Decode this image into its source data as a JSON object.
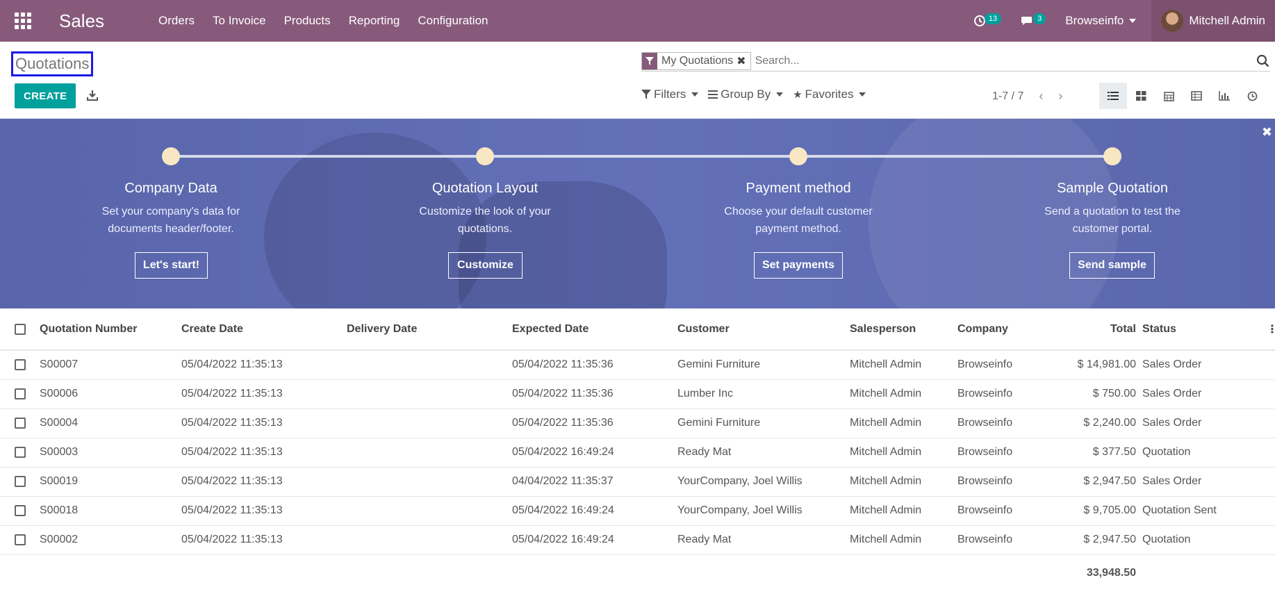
{
  "app": {
    "name": "Sales",
    "menu": [
      "Orders",
      "To Invoice",
      "Products",
      "Reporting",
      "Configuration"
    ],
    "activity_count": "13",
    "message_count": "3",
    "company": "Browseinfo",
    "user": "Mitchell Admin"
  },
  "control_panel": {
    "breadcrumb": "Quotations",
    "create_label": "CREATE",
    "search": {
      "facet": "My Quotations",
      "placeholder": "Search..."
    },
    "filters_label": "Filters",
    "groupby_label": "Group By",
    "favorites_label": "Favorites",
    "pager": "1-7 / 7"
  },
  "banner": {
    "steps": [
      {
        "title": "Company Data",
        "desc": "Set your company's data for documents header/footer.",
        "button": "Let's start!"
      },
      {
        "title": "Quotation Layout",
        "desc": "Customize the look of your quotations.",
        "button": "Customize"
      },
      {
        "title": "Payment method",
        "desc": "Choose your default customer payment method.",
        "button": "Set payments"
      },
      {
        "title": "Sample Quotation",
        "desc": "Send a quotation to test the customer portal.",
        "button": "Send sample"
      }
    ]
  },
  "table": {
    "columns": {
      "number": "Quotation Number",
      "create_date": "Create Date",
      "delivery_date": "Delivery Date",
      "expected_date": "Expected Date",
      "customer": "Customer",
      "salesperson": "Salesperson",
      "company": "Company",
      "total": "Total",
      "status": "Status"
    },
    "rows": [
      {
        "number": "S00007",
        "create_date": "05/04/2022 11:35:13",
        "delivery_date": "",
        "expected_date": "05/04/2022 11:35:36",
        "customer": "Gemini Furniture",
        "salesperson": "Mitchell Admin",
        "company": "Browseinfo",
        "total": "$ 14,981.00",
        "status": "Sales Order"
      },
      {
        "number": "S00006",
        "create_date": "05/04/2022 11:35:13",
        "delivery_date": "",
        "expected_date": "05/04/2022 11:35:36",
        "customer": "Lumber Inc",
        "salesperson": "Mitchell Admin",
        "company": "Browseinfo",
        "total": "$ 750.00",
        "status": "Sales Order"
      },
      {
        "number": "S00004",
        "create_date": "05/04/2022 11:35:13",
        "delivery_date": "",
        "expected_date": "05/04/2022 11:35:36",
        "customer": "Gemini Furniture",
        "salesperson": "Mitchell Admin",
        "company": "Browseinfo",
        "total": "$ 2,240.00",
        "status": "Sales Order"
      },
      {
        "number": "S00003",
        "create_date": "05/04/2022 11:35:13",
        "delivery_date": "",
        "expected_date": "05/04/2022 16:49:24",
        "customer": "Ready Mat",
        "salesperson": "Mitchell Admin",
        "company": "Browseinfo",
        "total": "$ 377.50",
        "status": "Quotation"
      },
      {
        "number": "S00019",
        "create_date": "05/04/2022 11:35:13",
        "delivery_date": "",
        "expected_date": "04/04/2022 11:35:37",
        "customer": "YourCompany, Joel Willis",
        "salesperson": "Mitchell Admin",
        "company": "Browseinfo",
        "total": "$ 2,947.50",
        "status": "Sales Order"
      },
      {
        "number": "S00018",
        "create_date": "05/04/2022 11:35:13",
        "delivery_date": "",
        "expected_date": "05/04/2022 16:49:24",
        "customer": "YourCompany, Joel Willis",
        "salesperson": "Mitchell Admin",
        "company": "Browseinfo",
        "total": "$ 9,705.00",
        "status": "Quotation Sent"
      },
      {
        "number": "S00002",
        "create_date": "05/04/2022 11:35:13",
        "delivery_date": "",
        "expected_date": "05/04/2022 16:49:24",
        "customer": "Ready Mat",
        "salesperson": "Mitchell Admin",
        "company": "Browseinfo",
        "total": "$ 2,947.50",
        "status": "Quotation"
      }
    ],
    "footer_total": "33,948.50"
  },
  "colors": {
    "navbar": "#875a7b",
    "primary": "#00a09d",
    "banner": "#6270b9",
    "step_dot": "#f8e7c2"
  },
  "icons": [
    "apps-icon",
    "activity-clock-icon",
    "messages-icon",
    "download-icon",
    "filter-icon",
    "search-icon",
    "groupby-icon",
    "star-icon",
    "chevron-left-icon",
    "chevron-right-icon",
    "list-view-icon",
    "kanban-view-icon",
    "calendar-view-icon",
    "pivot-view-icon",
    "graph-view-icon",
    "activity-view-icon",
    "close-icon",
    "optional-columns-icon"
  ]
}
